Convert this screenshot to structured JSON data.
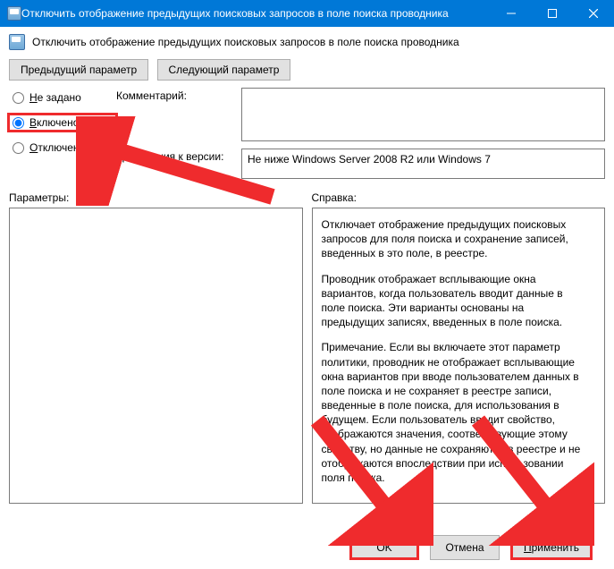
{
  "window": {
    "title": "Отключить отображение предыдущих поисковых запросов в поле поиска проводника"
  },
  "header": {
    "text": "Отключить отображение предыдущих поисковых запросов в поле поиска проводника"
  },
  "nav": {
    "prev": "Предыдущий параметр",
    "next": "Следующий параметр"
  },
  "radios": {
    "not_configured": "Не задано",
    "enabled": "Включено",
    "disabled": "Отключено",
    "selected": "enabled"
  },
  "labels": {
    "comment": "Комментарий:",
    "version_req": "Требования к версии:",
    "params": "Параметры:",
    "help": "Справка:"
  },
  "version_text": "Не ниже Windows Server 2008 R2 или Windows 7",
  "comment_text": "",
  "help_paragraphs": [
    "Отключает отображение предыдущих поисковых запросов для поля поиска и сохранение записей, введенных в это поле, в реестре.",
    "Проводник отображает всплывающие окна вариантов, когда пользователь вводит данные в поле поиска.  Эти варианты основаны на предыдущих записях, введенных в поле поиска.",
    "Примечание. Если вы включаете этот параметр политики, проводник не отображает всплывающие окна вариантов при вводе пользователем данных в поле поиска и не сохраняет в реестре записи, введенные в поле поиска, для использования в будущем.  Если пользователь вводит свойство, отображаются значения, соответствующие этому свойству, но данные не сохраняются в реестре и не отображаются впоследствии при использовании поля поиска."
  ],
  "footer": {
    "ok": "OK",
    "cancel": "Отмена",
    "apply": "Применить"
  }
}
